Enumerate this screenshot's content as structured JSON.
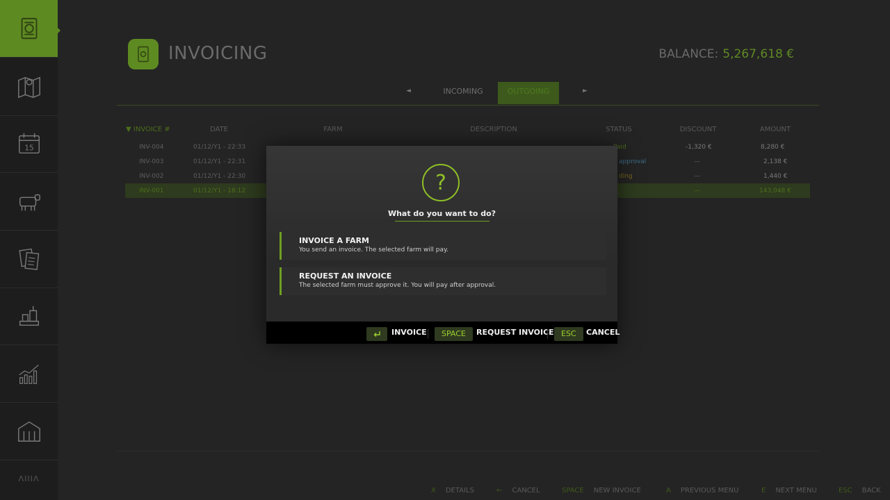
{
  "sidebar": {
    "items": [
      {
        "icon": "invoice-icon",
        "active": true
      },
      {
        "icon": "map-icon"
      },
      {
        "icon": "calendar-icon",
        "day": "15"
      },
      {
        "icon": "cow-icon"
      },
      {
        "icon": "contracts-icon"
      },
      {
        "icon": "production-icon"
      },
      {
        "icon": "statistics-icon"
      },
      {
        "icon": "barn-icon"
      }
    ],
    "bottom_text": "ΛΙΙΙΛ"
  },
  "header": {
    "title": "INVOICING",
    "balance_label": "BALANCE:",
    "balance_value": "5,267,618 €"
  },
  "tabs": {
    "incoming": "INCOMING",
    "outgoing": "OUTGOING",
    "active": "outgoing"
  },
  "table": {
    "columns": {
      "invoice": "INVOICE #",
      "date": "DATE",
      "farm": "FARM",
      "description": "DESCRIPTION",
      "status": "STATUS",
      "discount": "DISCOUNT",
      "amount": "AMOUNT"
    },
    "rows": [
      {
        "invoice": "INV-004",
        "date": "01/12/Y1 - 22:33",
        "status": "Paid",
        "discount": "-1,320 €",
        "amount": "8,280 €"
      },
      {
        "invoice": "INV-003",
        "date": "01/12/Y1 - 22:31",
        "status": "approval",
        "discount": "—",
        "amount": "2,138 €"
      },
      {
        "invoice": "INV-002",
        "date": "01/12/Y1 - 22:30",
        "status": "ding",
        "discount": "—",
        "amount": "1,440 €"
      },
      {
        "invoice": "INV-001",
        "date": "01/12/Y1 - 18:12",
        "status": "",
        "discount": "—",
        "amount": "143,048 €"
      }
    ]
  },
  "footer": {
    "hints": [
      {
        "key": "X",
        "label": "DETAILS"
      },
      {
        "key": "←",
        "label": "CANCEL"
      },
      {
        "key": "SPACE",
        "label": "NEW INVOICE"
      },
      {
        "key": "A",
        "label": "PREVIOUS MENU"
      },
      {
        "key": "E",
        "label": "NEXT MENU"
      },
      {
        "key": "ESC",
        "label": "BACK"
      }
    ]
  },
  "modal": {
    "symbol": "?",
    "title": "What do you want to do?",
    "options": [
      {
        "title": "INVOICE A FARM",
        "desc": "You send an invoice. The selected farm will pay."
      },
      {
        "title": "REQUEST AN INVOICE",
        "desc": "The selected farm must approve it. You will pay after approval."
      }
    ],
    "actions": [
      {
        "key_icon": "enter-key-icon",
        "label": "INVOICE"
      },
      {
        "key": "SPACE",
        "label": "REQUEST INVOICE"
      },
      {
        "key": "ESC",
        "label": "CANCEL"
      }
    ]
  },
  "colors": {
    "accent": "#8fbf26",
    "accent_dark": "#5e8a22",
    "background": "#242424",
    "sidebar": "#1d1d1d"
  }
}
